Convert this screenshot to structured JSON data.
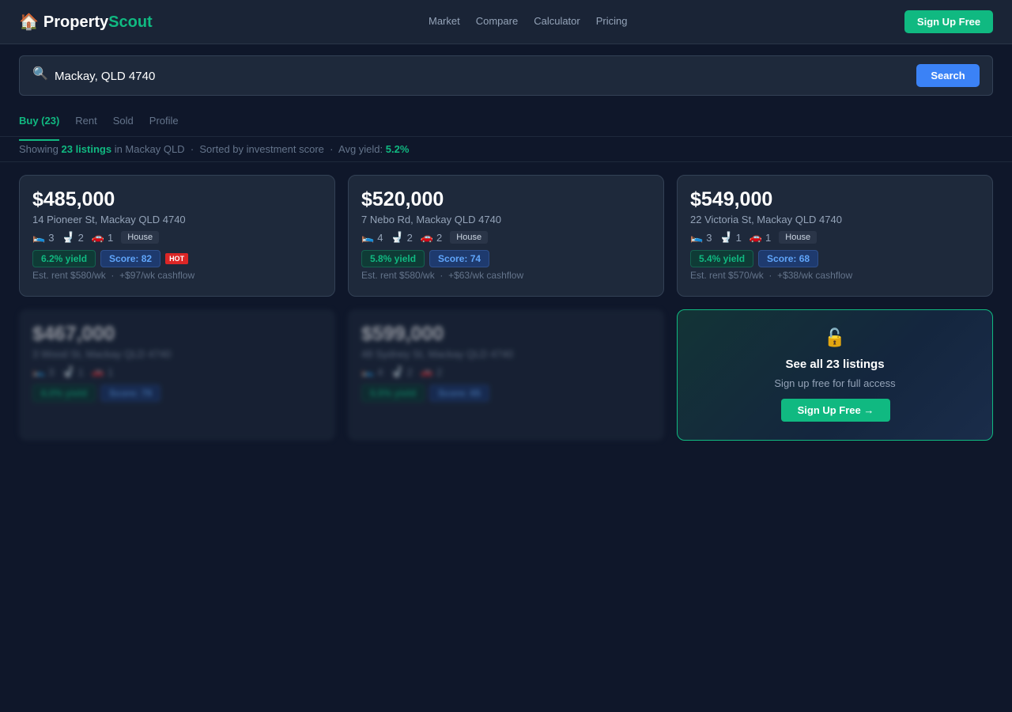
{
  "brand": {
    "name_a": "Property",
    "name_b": "Scout",
    "icon": "house-icon"
  },
  "nav": {
    "items": [
      "Market",
      "Compare",
      "Calculator",
      "Pricing"
    ],
    "signup_label": "Sign Up Free"
  },
  "search": {
    "value": "Mackay, QLD 4740",
    "button_label": "Search",
    "icon": "search-icon"
  },
  "tabs": [
    {
      "label": "Buy (23)",
      "active": true
    },
    {
      "label": "Rent",
      "active": false
    },
    {
      "label": "Sold",
      "active": false
    },
    {
      "label": "Profile",
      "active": false
    }
  ],
  "summary": {
    "prefix": "Showing",
    "count": "23 listings",
    "location": "in Mackay QLD",
    "sep": "·",
    "sort": "Sorted by investment score",
    "avg_label": "Avg yield:",
    "avg_value": "5.2%"
  },
  "listings": [
    {
      "price": "$485,000",
      "address": "14 Pioneer St, Mackay QLD 4740",
      "beds": "3",
      "baths": "2",
      "cars": "1",
      "type": "House",
      "yield": "6.2% yield",
      "score": "Score: 82",
      "hot": "HOT",
      "rent": "Est. rent $580/wk",
      "cashflow": "+$97/wk cashflow"
    },
    {
      "price": "$520,000",
      "address": "7 Nebo Rd, Mackay QLD 4740",
      "beds": "4",
      "baths": "2",
      "cars": "2",
      "type": "House",
      "yield": "5.8% yield",
      "score": "Score: 74",
      "rent": "Est. rent $580/wk",
      "cashflow": "+$63/wk cashflow"
    },
    {
      "price": "$549,000",
      "address": "22 Victoria St, Mackay QLD 4740",
      "beds": "3",
      "baths": "1",
      "cars": "1",
      "type": "House",
      "yield": "5.4% yield",
      "score": "Score: 68",
      "rent": "Est. rent $570/wk",
      "cashflow": "+$38/wk cashflow"
    },
    {
      "price": "$467,000",
      "address": "3 Wood St, Mackay QLD 4740",
      "beds": "3",
      "baths": "1",
      "cars": "1",
      "yield": "6.0% yield",
      "score": "Score: 79"
    },
    {
      "price": "$599,000",
      "address": "48 Sydney St, Mackay QLD 4740",
      "beds": "4",
      "baths": "2",
      "cars": "2",
      "yield": "5.5% yield",
      "score": "Score: 65"
    }
  ],
  "upsell": {
    "icon": "lock-icon",
    "title": "See all 23 listings",
    "subtitle": "Sign up free for full access",
    "button_label": "Sign Up Free →"
  },
  "colors": {
    "accent": "#10b981",
    "primary": "#3b82f6",
    "background": "#0f172a",
    "card": "#1e293b",
    "hot": "#dc2626"
  }
}
